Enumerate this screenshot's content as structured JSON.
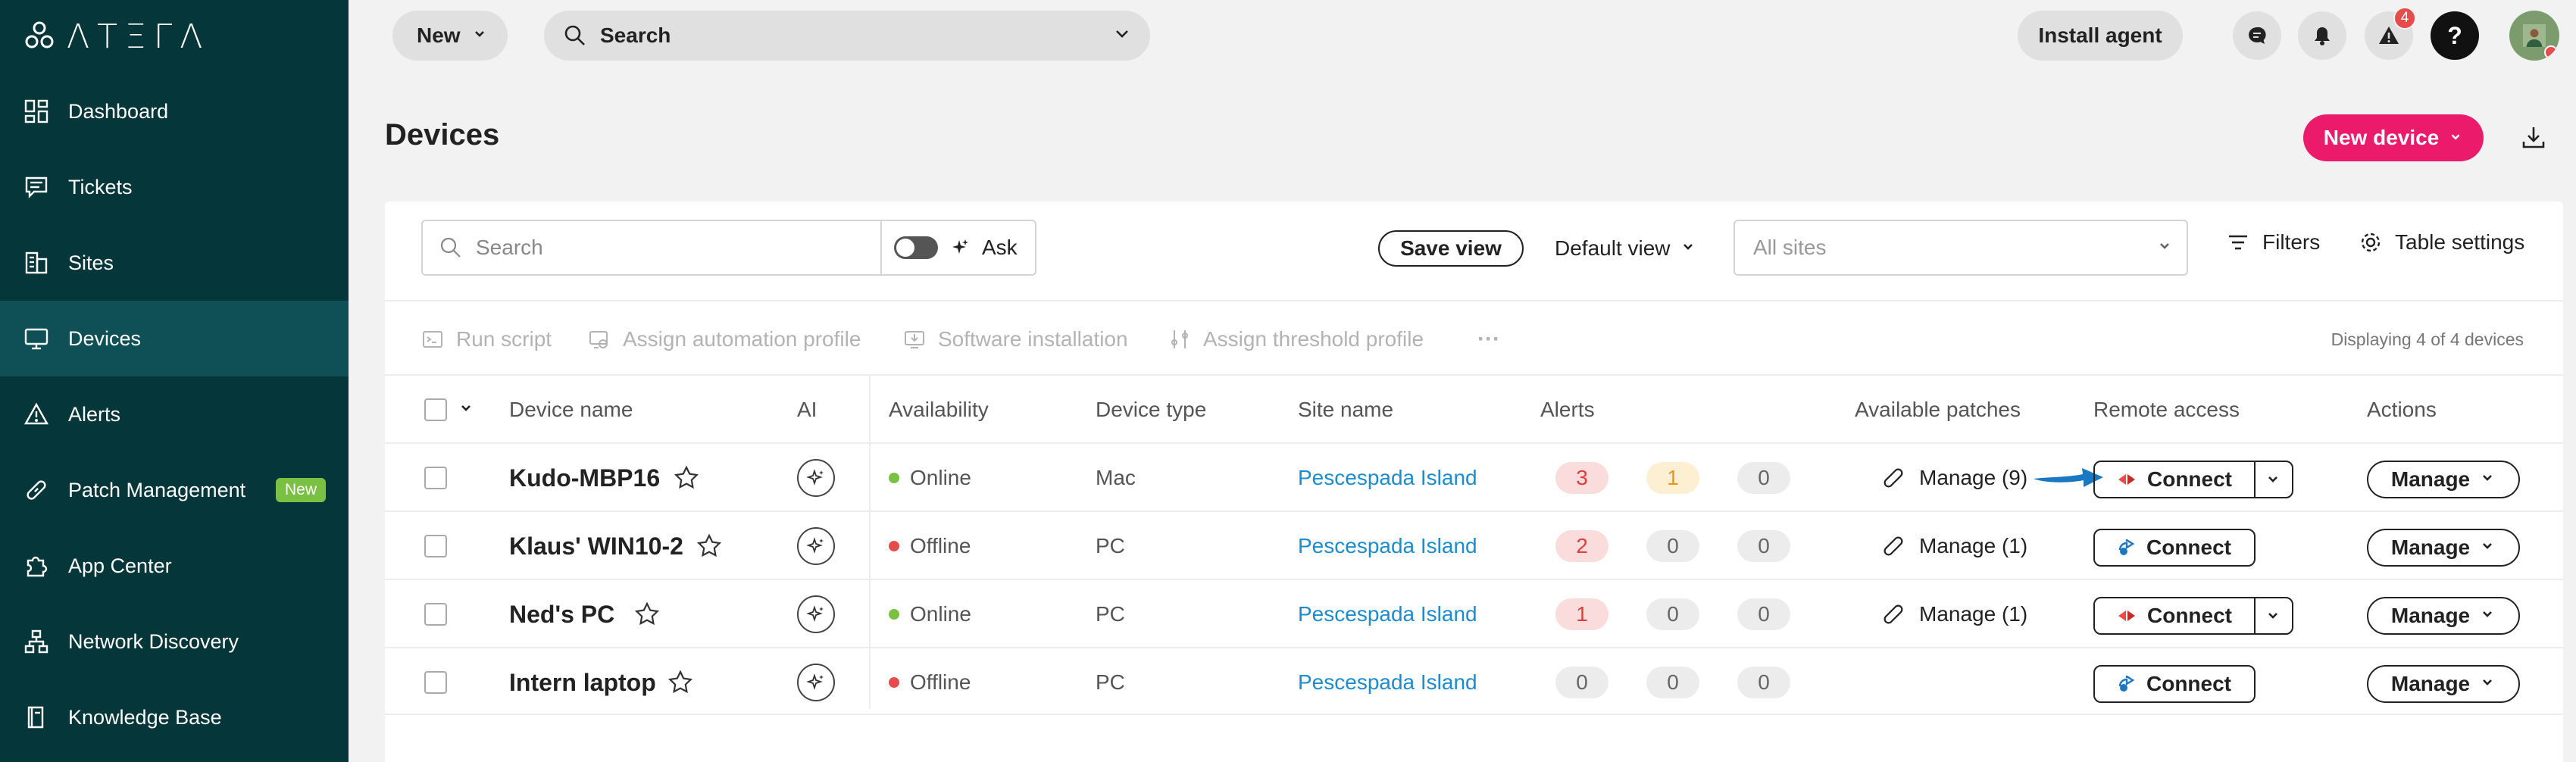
{
  "sidebar": {
    "logo_text": "ΛΤΞΓΛ",
    "items": [
      {
        "label": "Dashboard",
        "icon": "dashboard-icon"
      },
      {
        "label": "Tickets",
        "icon": "tickets-icon"
      },
      {
        "label": "Sites",
        "icon": "sites-icon"
      },
      {
        "label": "Devices",
        "icon": "devices-icon",
        "active": true
      },
      {
        "label": "Alerts",
        "icon": "alerts-icon"
      },
      {
        "label": "Patch Management",
        "icon": "patch-icon",
        "badge": "New"
      },
      {
        "label": "App Center",
        "icon": "app-center-icon"
      },
      {
        "label": "Network Discovery",
        "icon": "network-icon"
      },
      {
        "label": "Knowledge Base",
        "icon": "knowledge-base-icon"
      }
    ]
  },
  "topbar": {
    "new_label": "New",
    "search_label": "Search",
    "install_agent_label": "Install agent",
    "alerts_count": "4",
    "help_label": "?"
  },
  "page": {
    "title": "Devices",
    "new_device_label": "New device"
  },
  "toolbar": {
    "search_placeholder": "Search",
    "ask_label": "Ask",
    "save_view_label": "Save view",
    "default_view_label": "Default view",
    "sites_placeholder": "All sites",
    "filters_label": "Filters",
    "table_settings_label": "Table settings"
  },
  "bulk_actions": {
    "run_script": "Run script",
    "assign_automation": "Assign automation profile",
    "software_installation": "Software installation",
    "assign_threshold": "Assign threshold profile",
    "more": "···",
    "displaying": "Displaying 4 of 4 devices"
  },
  "table": {
    "headers": {
      "device_name": "Device name",
      "ai": "AI",
      "availability": "Availability",
      "device_type": "Device type",
      "site_name": "Site name",
      "alerts": "Alerts",
      "patches": "Available patches",
      "remote_access": "Remote access",
      "actions": "Actions"
    },
    "rows": [
      {
        "name": "Kudo-MBP16",
        "availability": "Online",
        "type": "Mac",
        "site": "Pescespada Island",
        "alerts": [
          "3",
          "1",
          "0"
        ],
        "patches": "Manage (9)",
        "connect": "Connect",
        "manage": "Manage"
      },
      {
        "name": "Klaus' WIN10-2",
        "availability": "Offline",
        "type": "PC",
        "site": "Pescespada Island",
        "alerts": [
          "2",
          "0",
          "0"
        ],
        "patches": "Manage (1)",
        "connect": "Connect",
        "manage": "Manage"
      },
      {
        "name": "Ned's PC",
        "availability": "Online",
        "type": "PC",
        "site": "Pescespada Island",
        "alerts": [
          "1",
          "0",
          "0"
        ],
        "patches": "Manage (1)",
        "connect": "Connect",
        "manage": "Manage"
      },
      {
        "name": "Intern laptop",
        "availability": "Offline",
        "type": "PC",
        "site": "Pescespada Island",
        "alerts": [
          "0",
          "0",
          "0"
        ],
        "patches": "",
        "connect": "Connect",
        "manage": "Manage"
      }
    ]
  },
  "colors": {
    "sidebar_bg": "#04363a",
    "accent_pink": "#ec1a6a",
    "online": "#7ac043",
    "offline": "#e74c4c",
    "link": "#1a8cd0"
  }
}
